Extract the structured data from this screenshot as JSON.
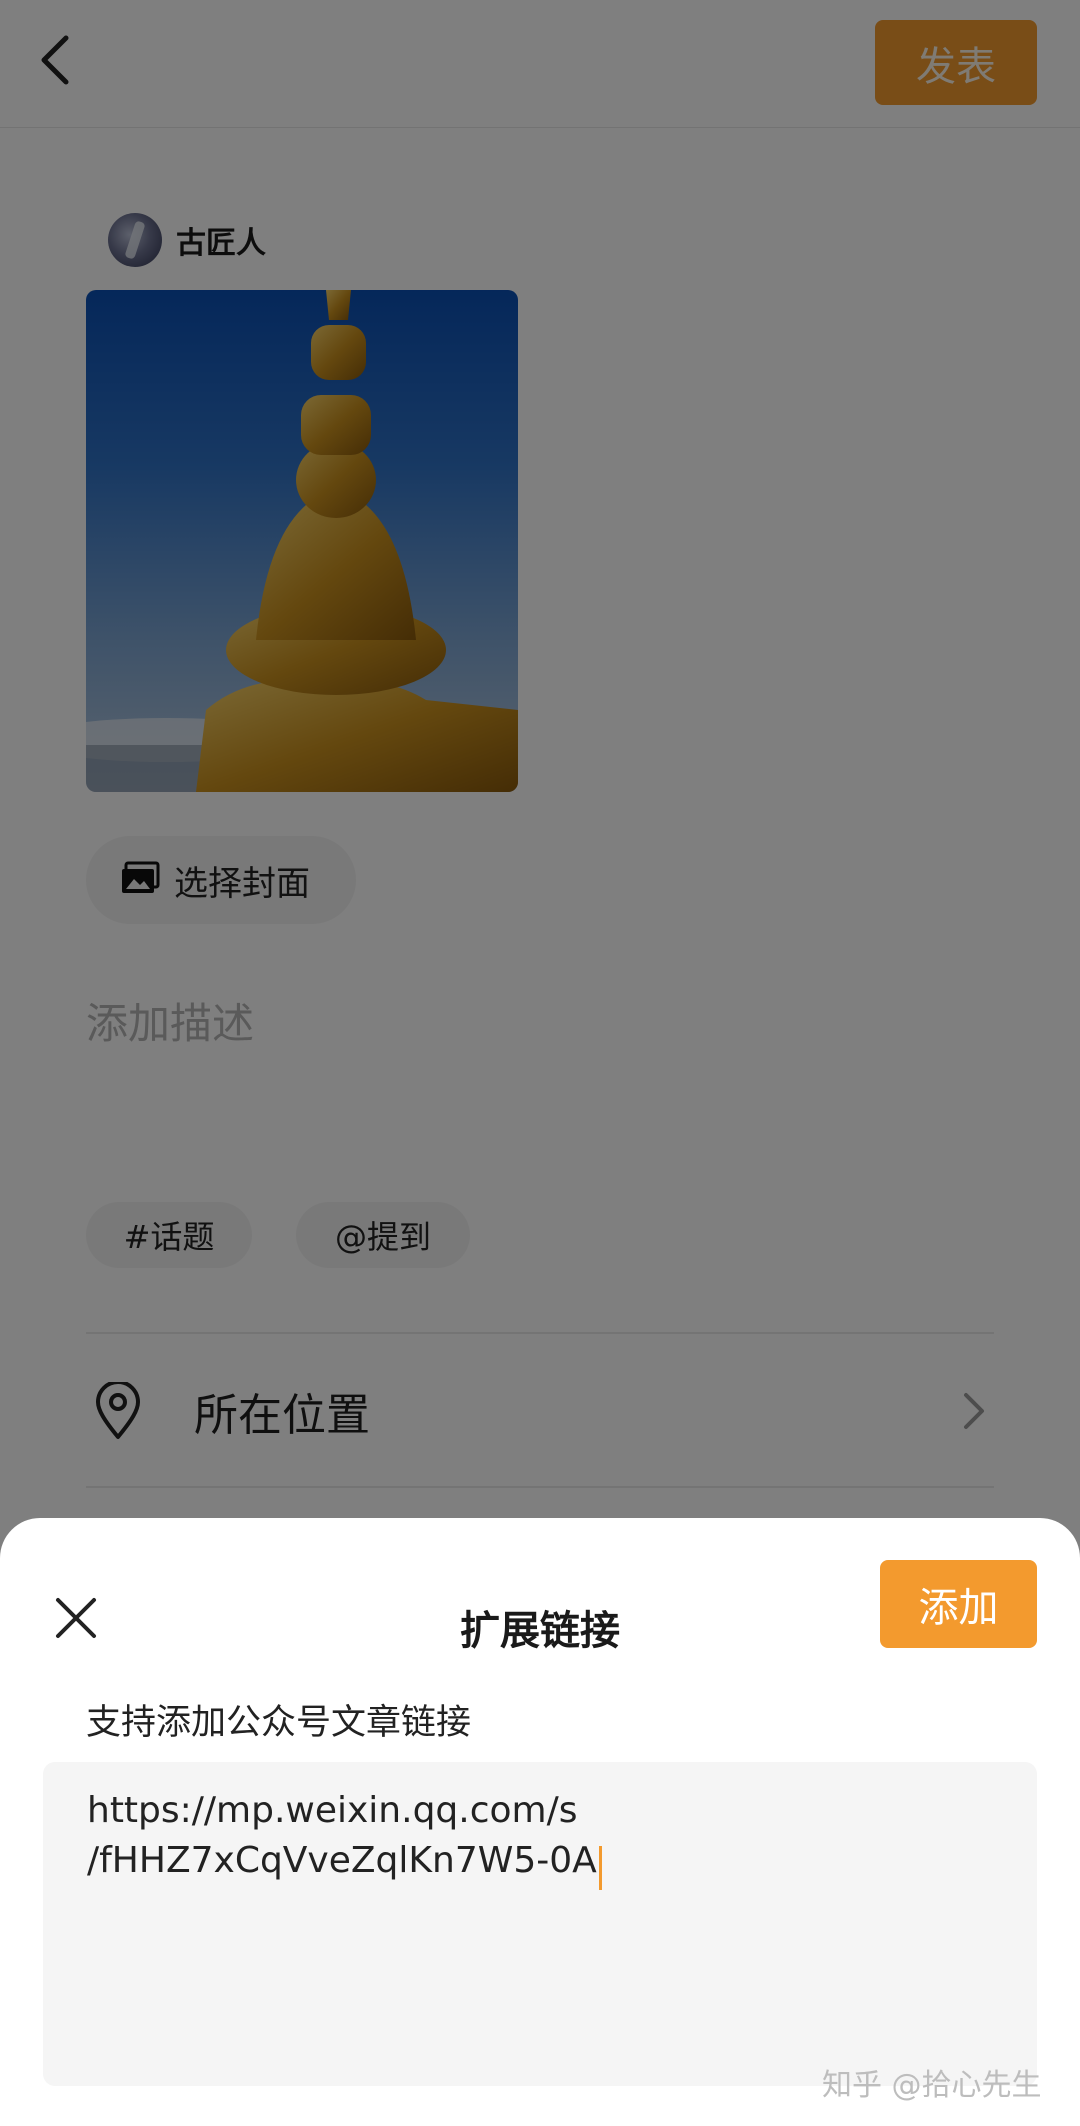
{
  "header": {
    "publish_label": "发表"
  },
  "author": {
    "name": "古匠人"
  },
  "editor": {
    "choose_cover_label": "选择封面",
    "description_placeholder": "添加描述",
    "topic_chip": "#话题",
    "mention_chip": "@提到",
    "location_label": "所在位置"
  },
  "sheet": {
    "title": "扩展链接",
    "add_label": "添加",
    "hint": "支持添加公众号文章链接",
    "link_value": "https://mp.weixin.qq.com/s\n/fHHZ7xCqVveZqlKn7W5-0A"
  },
  "watermark": "知乎 @拾心先生",
  "colors": {
    "accent": "#f39a2e",
    "overlay": "rgba(0,0,0,0.5)"
  },
  "icons": [
    "back-arrow-icon",
    "image-icon",
    "location-pin-icon",
    "chevron-right-icon",
    "close-icon"
  ]
}
